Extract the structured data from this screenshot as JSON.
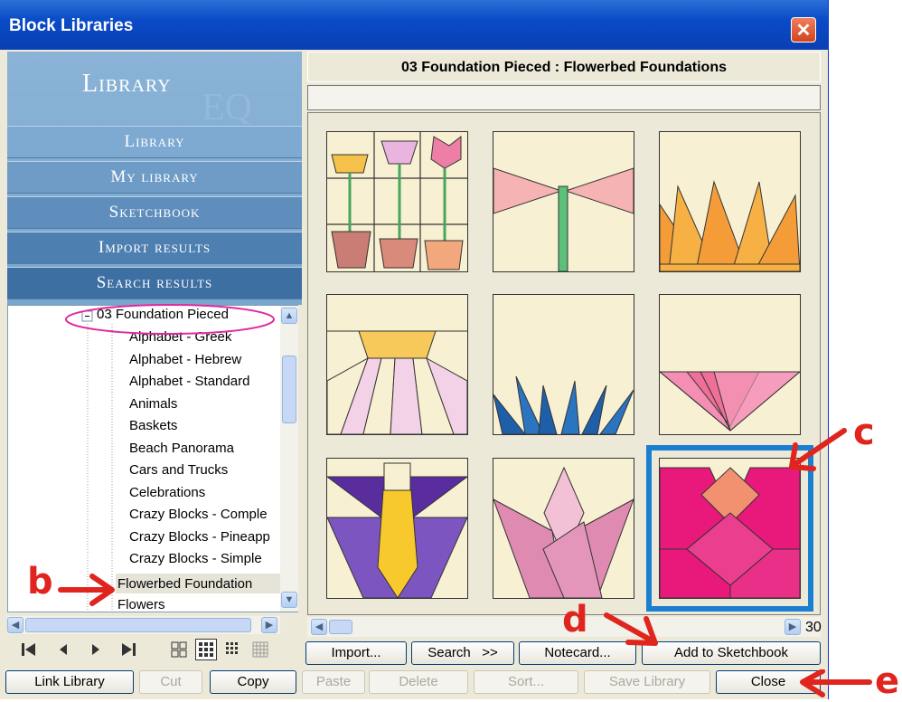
{
  "window": {
    "title": "Block Libraries",
    "close_glyph": "✕"
  },
  "sidebar": {
    "header": "Library",
    "nav": [
      "Library",
      "My library",
      "Sketchbook",
      "Import results",
      "Search results"
    ],
    "nav_colors": [
      "#7ea9d0",
      "#6f9cc7",
      "#5f8ebd",
      "#4e7fb1",
      "#3e6fa3"
    ]
  },
  "tree": {
    "root": "03 Foundation Pieced",
    "root_toggle": "−",
    "items": [
      "Alphabet - Greek",
      "Alphabet - Hebrew",
      "Alphabet - Standard",
      "Animals",
      "Baskets",
      "Beach Panorama",
      "Cars and Trucks",
      "Celebrations",
      "Crazy Blocks - Comple",
      "Crazy Blocks - Pineapp",
      "Crazy Blocks - Simple",
      "Flowerbed Foundation",
      "Flowers"
    ],
    "selected": "Flowerbed Foundation"
  },
  "navbar": {
    "icons": [
      "first-icon",
      "prev-icon",
      "next-icon",
      "last-icon",
      "view-2x2-icon",
      "view-3x3-icon",
      "view-4x4-icon",
      "view-5x5-icon"
    ]
  },
  "main": {
    "heading": "03 Foundation Pieced  :  Flowerbed Foundations",
    "page_count": "30"
  },
  "buttons_row1": [
    "Import...",
    "Search   >>",
    "Notecard...",
    "Add to Sketchbook"
  ],
  "buttons_row2": [
    {
      "label": "Link Library",
      "enabled": true
    },
    {
      "label": "Cut",
      "enabled": false
    },
    {
      "label": "Copy",
      "enabled": true
    },
    {
      "label": "Paste",
      "enabled": false
    },
    {
      "label": "Delete",
      "enabled": false
    },
    {
      "label": "Sort...",
      "enabled": false
    },
    {
      "label": "Save Library",
      "enabled": false
    },
    {
      "label": "Close",
      "enabled": true
    }
  ],
  "annotations": [
    "b",
    "c",
    "d",
    "e"
  ],
  "colors": {
    "accent_red": "#e0251f",
    "highlight_magenta": "#e02aa0",
    "selection_blue": "#1a7fd0"
  }
}
